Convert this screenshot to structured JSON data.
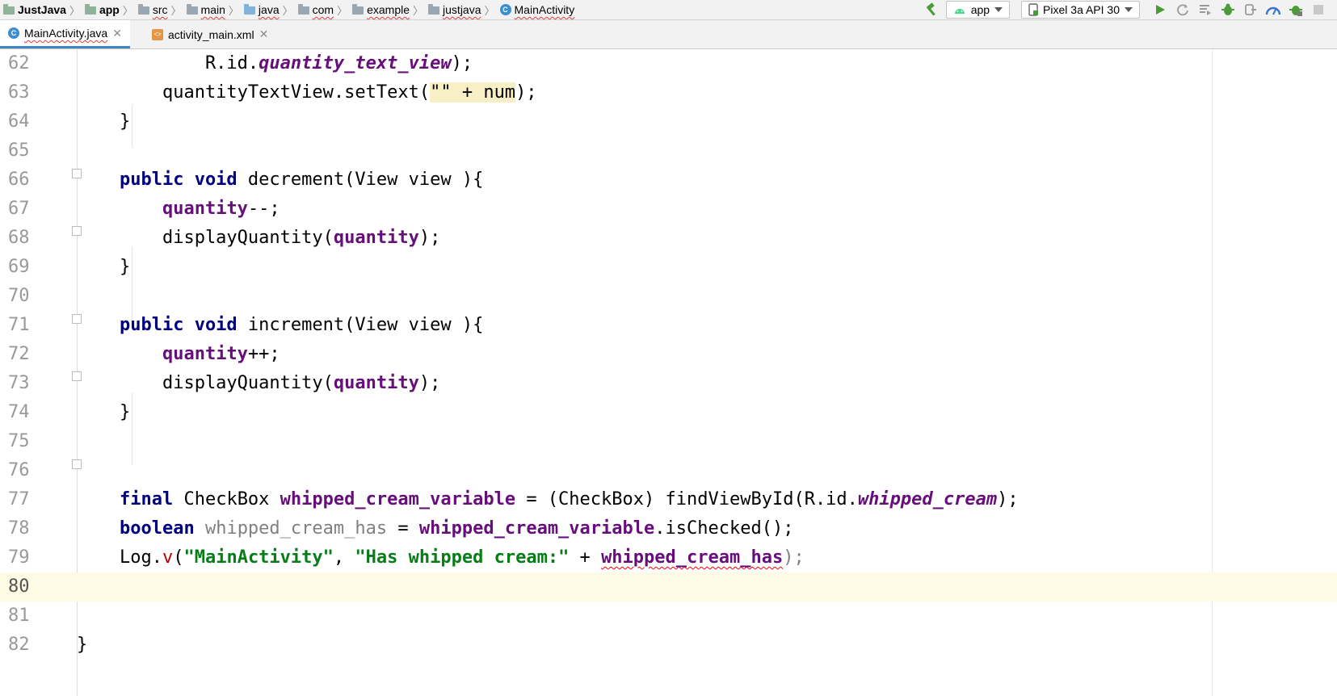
{
  "breadcrumbs": [
    {
      "label": "JustJava",
      "icon": "module-folder-icon"
    },
    {
      "label": "app",
      "icon": "module-folder-icon"
    },
    {
      "label": "src",
      "icon": "folder-icon"
    },
    {
      "label": "main",
      "icon": "folder-icon"
    },
    {
      "label": "java",
      "icon": "source-folder-icon"
    },
    {
      "label": "com",
      "icon": "package-icon"
    },
    {
      "label": "example",
      "icon": "package-icon"
    },
    {
      "label": "justjava",
      "icon": "package-icon"
    },
    {
      "label": "MainActivity",
      "icon": "class-icon"
    }
  ],
  "toolbar": {
    "run_config": "app",
    "device": "Pixel 3a API 30",
    "icons": [
      "hammer-icon",
      "android-icon",
      "device-icon",
      "run-icon",
      "apply-changes-icon",
      "apply-code-changes-icon",
      "debug-icon",
      "attach-debugger-icon",
      "profile-icon",
      "debug-app-icon",
      "stop-icon"
    ]
  },
  "tabs": [
    {
      "label": "MainActivity.java",
      "icon": "class-icon",
      "active": true
    },
    {
      "label": "activity_main.xml",
      "icon": "xml-file-icon",
      "active": false
    }
  ],
  "editor": {
    "current_line": 80,
    "lines": [
      {
        "n": "62"
      },
      {
        "n": "63"
      },
      {
        "n": "64"
      },
      {
        "n": "65"
      },
      {
        "n": "66"
      },
      {
        "n": "67"
      },
      {
        "n": "68"
      },
      {
        "n": "69"
      },
      {
        "n": "70"
      },
      {
        "n": "71"
      },
      {
        "n": "72"
      },
      {
        "n": "73"
      },
      {
        "n": "74"
      },
      {
        "n": "75"
      },
      {
        "n": "76"
      },
      {
        "n": "77"
      },
      {
        "n": "78"
      },
      {
        "n": "79"
      },
      {
        "n": "80"
      },
      {
        "n": "81"
      },
      {
        "n": "82"
      }
    ],
    "tokens": {
      "l62a": "            R.id.",
      "l62b": "quantity_text_view",
      "l62c": ");",
      "l63a": "        quantityTextView.setText(",
      "l63b": "\"\" + num",
      "l63c": ");",
      "l64": "    }",
      "l66kw": "    public void ",
      "l66rest": "decrement(View view ){",
      "l67a": "        ",
      "l67b": "quantity",
      "l67c": "--;",
      "l68a": "        displayQuantity(",
      "l68b": "quantity",
      "l68c": ");",
      "l69": "    }",
      "l71kw": "    public void ",
      "l71rest": "increment(View view ){",
      "l72a": "        ",
      "l72b": "quantity",
      "l72c": "++;",
      "l73a": "        displayQuantity(",
      "l73b": "quantity",
      "l73c": ");",
      "l74": "    }",
      "l77a": "    ",
      "l77kw": "final",
      "l77b": " CheckBox ",
      "l77c": "whipped_cream_variable",
      "l77d": " = (CheckBox) findViewById(R.id.",
      "l77e": "whipped_cream",
      "l77f": ");",
      "l78a": "    ",
      "l78kw": "boolean",
      "l78b": " ",
      "l78c": "whipped_cream_has",
      "l78d": " = ",
      "l78e": "whipped_cream_variable",
      "l78f": ".isChecked();",
      "l79a": "    Log.",
      "l79b": "v",
      "l79c": "(",
      "l79d": "\"MainActivity\"",
      "l79e": ", ",
      "l79f": "\"Has whipped cream:\"",
      "l79g": " + ",
      "l79h": "whipped_cream_has",
      "l79i": ");",
      "l82": "}"
    }
  }
}
